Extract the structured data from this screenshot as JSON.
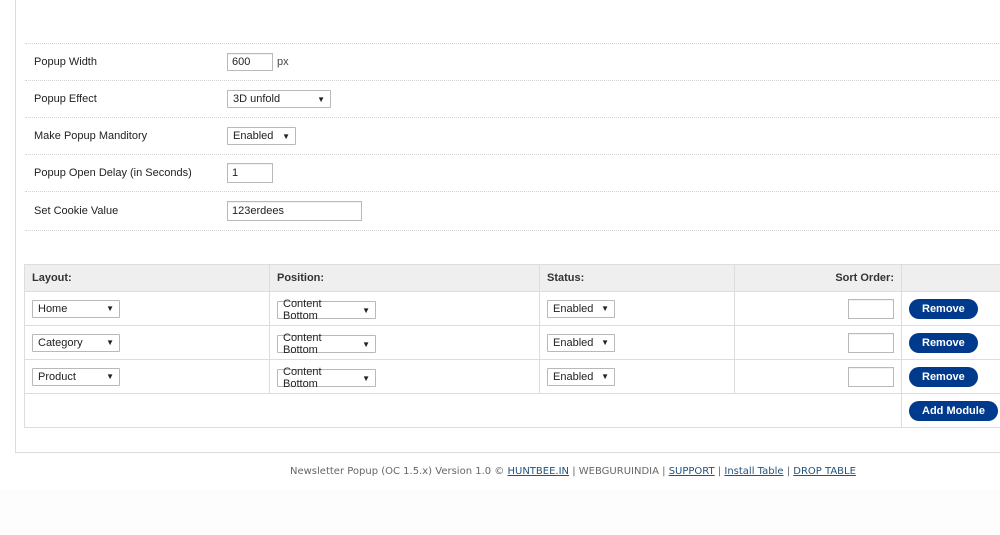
{
  "settings": {
    "popup_width": {
      "label": "Popup Width",
      "value": "600",
      "unit": "px"
    },
    "popup_effect": {
      "label": "Popup Effect",
      "selected": "3D unfold"
    },
    "make_popup_mandatory": {
      "label": "Make Popup Manditory",
      "selected": "Enabled"
    },
    "popup_open_delay": {
      "label": "Popup Open Delay (in Seconds)",
      "value": "1"
    },
    "cookie_value": {
      "label": "Set Cookie Value",
      "value": "123erdees"
    }
  },
  "modules": {
    "headers": {
      "layout": "Layout:",
      "position": "Position:",
      "status": "Status:",
      "sort_order": "Sort Order:"
    },
    "rows": [
      {
        "layout": "Home",
        "position": "Content Bottom",
        "status": "Enabled",
        "sort_order": "",
        "remove_label": "Remove"
      },
      {
        "layout": "Category",
        "position": "Content Bottom",
        "status": "Enabled",
        "sort_order": "",
        "remove_label": "Remove"
      },
      {
        "layout": "Product",
        "position": "Content Bottom",
        "status": "Enabled",
        "sort_order": "",
        "remove_label": "Remove"
      }
    ],
    "add_module_label": "Add Module"
  },
  "footer": {
    "text": "Newsletter Popup (OC 1.5.x) Version 1.0 ©",
    "huntbee_link": "HUNTBEE.IN",
    "separator": "|",
    "webguru": "WEBGURUINDIA",
    "support_link": "SUPPORT",
    "install_table_link": "Install Table",
    "drop_table_link": "DROP TABLE"
  },
  "icons": {
    "dropdown": "▼"
  },
  "colors": {
    "button_bg": "#003a8c",
    "header_bg": "#efefef",
    "link": "#23527c"
  }
}
